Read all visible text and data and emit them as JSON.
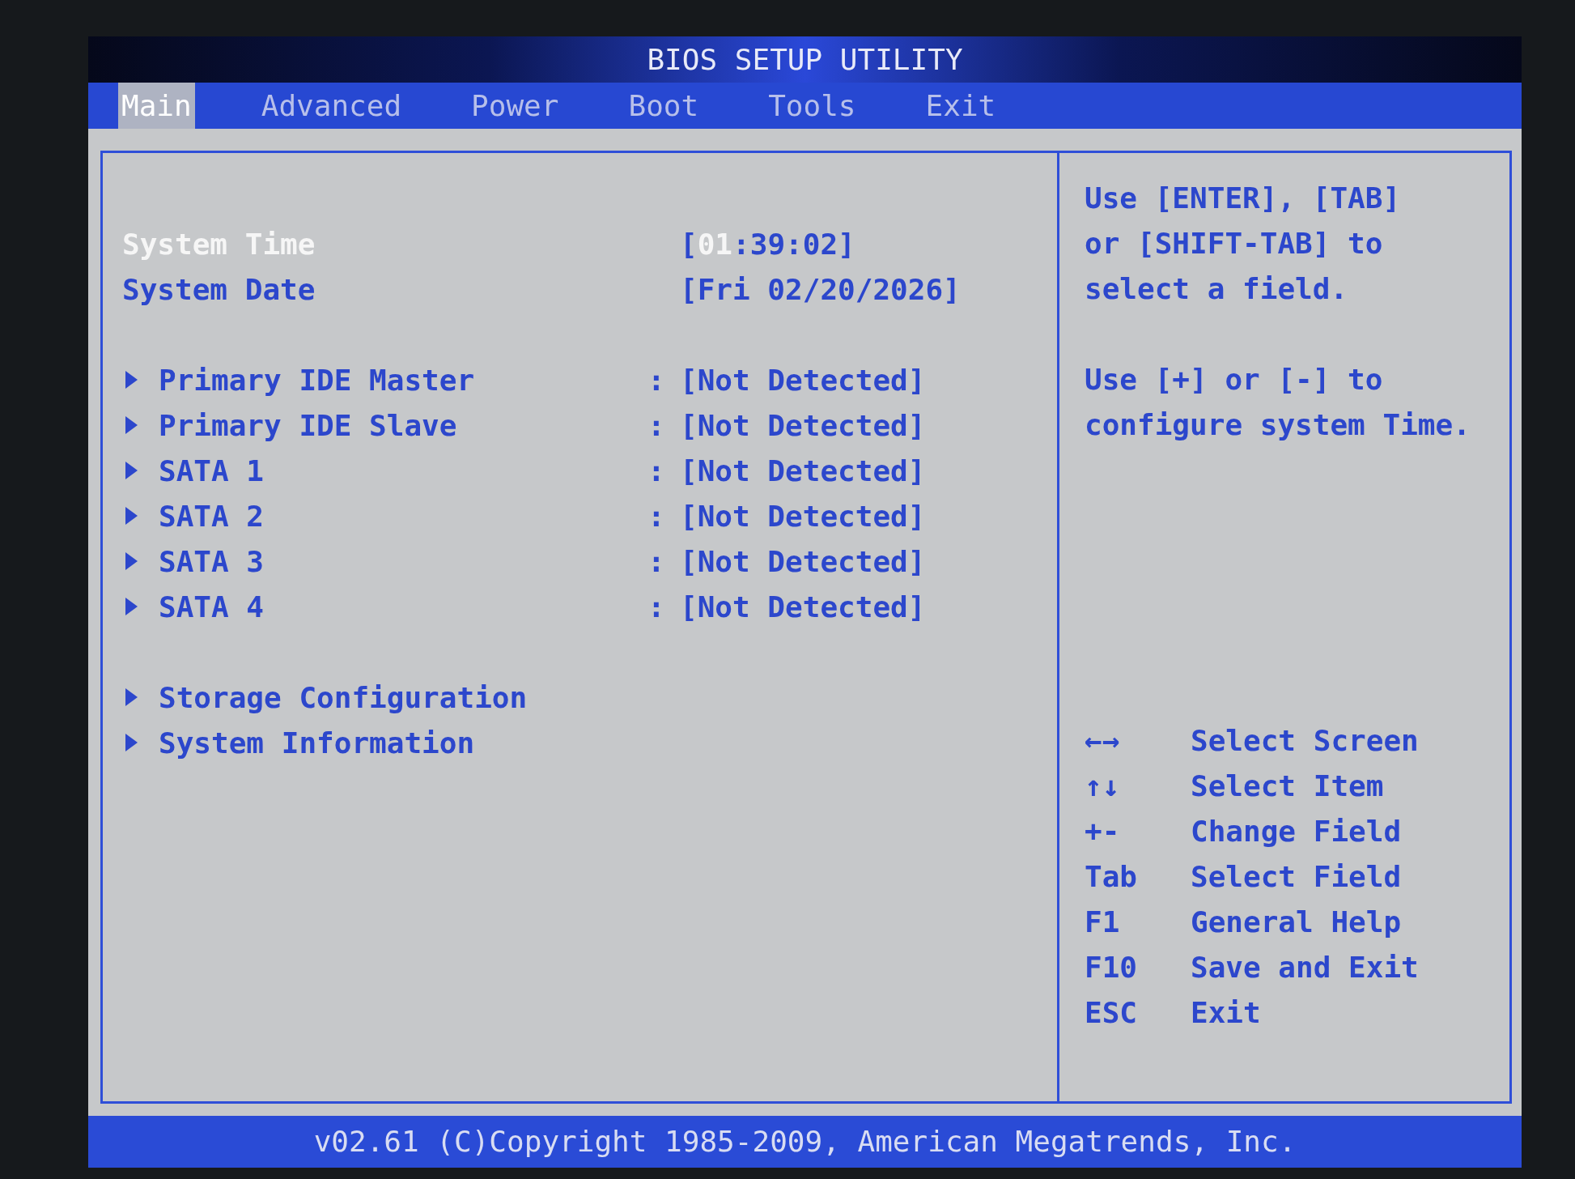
{
  "title": "BIOS SETUP UTILITY",
  "tabs": [
    {
      "label": "Main",
      "selected": true
    },
    {
      "label": "Advanced",
      "selected": false
    },
    {
      "label": "Power",
      "selected": false
    },
    {
      "label": "Boot",
      "selected": false
    },
    {
      "label": "Tools",
      "selected": false
    },
    {
      "label": "Exit",
      "selected": false
    }
  ],
  "main_panel": {
    "settings": [
      {
        "label": "System Time",
        "value": "[**01**:39:02]",
        "selected": true
      },
      {
        "label": "System Date",
        "value": "[Fri 02/20/2026]",
        "selected": false
      }
    ],
    "devices": [
      {
        "label": "Primary IDE Master",
        "separator": ":",
        "value": "[Not Detected]",
        "selected": false
      },
      {
        "label": "Primary IDE Slave",
        "separator": ":",
        "value": "[Not Detected]",
        "selected": false
      },
      {
        "label": "SATA 1",
        "separator": ":",
        "value": "[Not Detected]",
        "selected": false
      },
      {
        "label": "SATA 2",
        "separator": ":",
        "value": "[Not Detected]",
        "selected": false
      },
      {
        "label": "SATA 3",
        "separator": ":",
        "value": "[Not Detected]",
        "selected": false
      },
      {
        "label": "SATA 4",
        "separator": ":",
        "value": "[Not Detected]",
        "selected": false
      }
    ],
    "submenus": [
      {
        "label": "Storage Configuration",
        "selected": false
      },
      {
        "label": "System Information",
        "selected": false
      }
    ]
  },
  "help_panel": {
    "paragraphs": [
      [
        "Use [ENTER], [TAB]",
        "or [SHIFT-TAB] to",
        "select a field."
      ],
      [
        "Use [+] or [-] to",
        "configure system Time."
      ]
    ],
    "legend": [
      {
        "key": "←→",
        "action": "Select Screen"
      },
      {
        "key": "↑↓",
        "action": "Select Item"
      },
      {
        "key": "+-",
        "action": "Change Field"
      },
      {
        "key": "Tab",
        "action": "Select Field"
      },
      {
        "key": "F1",
        "action": "General Help"
      },
      {
        "key": "F10",
        "action": "Save and Exit"
      },
      {
        "key": "ESC",
        "action": "Exit"
      }
    ]
  },
  "footer": "v02.61 (C)Copyright 1985-2009, American Megatrends, Inc."
}
